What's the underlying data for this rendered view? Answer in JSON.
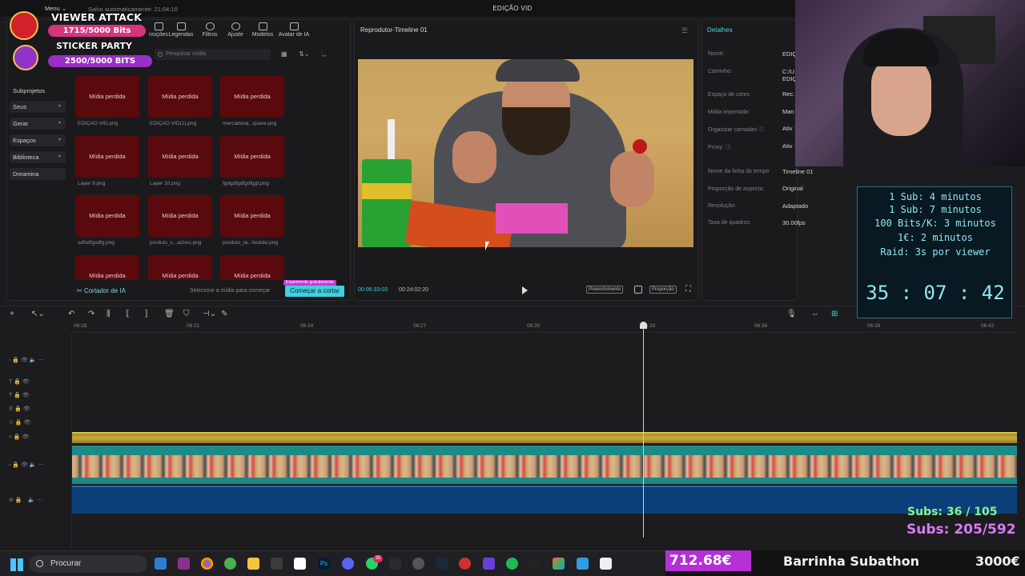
{
  "app": {
    "window_title": "EDIÇÃO VID",
    "menu_label": "Menu",
    "autosave": "Salvo automaticamente: 21:04:10"
  },
  "toolstrip": [
    {
      "label": "nsições"
    },
    {
      "label": "Legendas"
    },
    {
      "label": "Filtros"
    },
    {
      "label": "Ajuste"
    },
    {
      "label": "Modelos"
    },
    {
      "label": "Avatar de IA"
    }
  ],
  "media": {
    "search_placeholder": "Pesquisar mídia",
    "nav": [
      {
        "label": "Subprojetos"
      },
      {
        "label": "Seus"
      },
      {
        "label": "Gerar"
      },
      {
        "label": "Espaços"
      },
      {
        "label": "Biblioteca"
      },
      {
        "label": "Dreamina"
      }
    ],
    "tiles": [
      {
        "label": "Mídia perdida",
        "name": "EDIÇÃO VID.png"
      },
      {
        "label": "Mídia perdida",
        "name": "EDIÇÃO VID(1).png"
      },
      {
        "label": "Mídia perdida",
        "name": "mercadona...quare.png"
      },
      {
        "label": "Mídia perdida",
        "name": "Layer 9.png"
      },
      {
        "label": "Mídia perdida",
        "name": "Layer 10.png"
      },
      {
        "label": "Mídia perdida",
        "name": "fgdgdfgdfgdfggf.png"
      },
      {
        "label": "Mídia perdida",
        "name": "sdfsdfgsdfg.png"
      },
      {
        "label": "Mídia perdida",
        "name": "produto_c...achos.png"
      },
      {
        "label": "Mídia perdida",
        "name": "produto_ta...heddar.png"
      },
      {
        "label": "Mídia perdida",
        "name": ""
      },
      {
        "label": "Mídia perdida",
        "name": ""
      },
      {
        "label": "Mídia perdida",
        "name": ""
      }
    ],
    "cortador": "Cortador de IA",
    "select_msg": "Selecione a mídia para começar",
    "cortar_btn": "Começar a cortar",
    "tag": "Experimente gratuitamente"
  },
  "player": {
    "title": "Reprodutor-Timeline 01",
    "time_current": "00:06:33:03",
    "time_total": "00:24:02:20",
    "btn_fill": "Preenchimento",
    "btn_ratio": "Proporção"
  },
  "details": {
    "title": "Detalhes",
    "rows": [
      {
        "label": "Nome:",
        "value": "EDIÇ"
      },
      {
        "label": "Caminho:",
        "value": "C:/U"
      },
      {
        "label": "",
        "value": "EDIÇ"
      },
      {
        "label": "Espaço de cores",
        "value": "Rec."
      },
      {
        "label": "Mídia importada:",
        "value": "Man"
      },
      {
        "label": "Organizar camadas ⓘ",
        "value": "Ativ"
      },
      {
        "label": "Proxy: ⓘ",
        "value": "Ativ"
      },
      {
        "label": "Nome da linha do tempo",
        "value": "Timeline 01"
      },
      {
        "label": "Proporção de aspecto:",
        "value": "Original"
      },
      {
        "label": "Resolução:",
        "value": "Adaptado"
      },
      {
        "label": "Taxa de quadros:",
        "value": "30.00fps"
      }
    ]
  },
  "timeline": {
    "ruler": [
      "06:18",
      "06:21",
      "06:24",
      "06:27",
      "06:30",
      "06:33",
      "06:36",
      "06:39",
      "06:42"
    ],
    "playhead_time": "06:33"
  },
  "overlay": {
    "viewer_attack": "VIEWER ATTACK",
    "viewer_progress": "1715/5000 Bits",
    "sticker_party": "STICKER PARTY",
    "sticker_progress": "2500/5000 BITS",
    "sub_lines": [
      "1 Sub: 4 minutos",
      "1 Sub: 7 minutos",
      "100 Bits/K: 3 minutos",
      "1€: 2 minutos",
      "Raid: 3s por viewer"
    ],
    "timer": "35 : 07 : 42",
    "subs_a": "Subs: 36 / 105",
    "subs_b": "Subs: 205/592"
  },
  "taskbar": {
    "search": "Procurar",
    "badge": "35"
  },
  "barrinha": {
    "current": "712.68€",
    "label": "Barrinha Subathon",
    "goal": "3000€",
    "progress": 0.2376
  }
}
